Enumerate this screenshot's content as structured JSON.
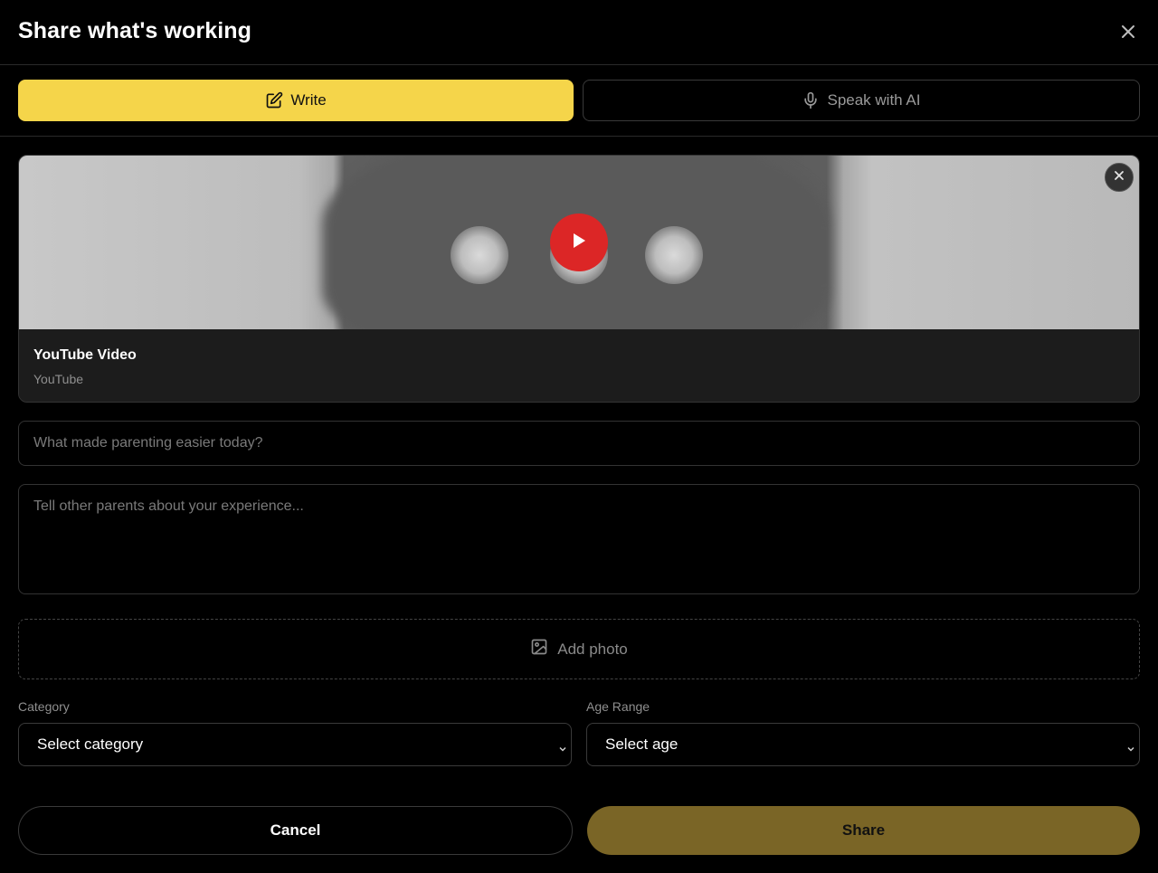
{
  "dialog": {
    "title": "Share what's working",
    "close_icon": "close-icon"
  },
  "modes": {
    "write": {
      "label": "Write",
      "icon": "edit-icon",
      "active": true,
      "color": "#f5d54a"
    },
    "speak": {
      "label": "Speak with AI",
      "icon": "microphone-icon",
      "active": false
    }
  },
  "video": {
    "title": "YouTube Video",
    "source": "YouTube",
    "play_icon": "play-icon",
    "remove_icon": "close-icon",
    "play_color": "#dc2626"
  },
  "form": {
    "title_placeholder": "What made parenting easier today?",
    "story_placeholder": "Tell other parents about your experience...",
    "add_photo_label": "Add photo",
    "add_photo_icon": "image-icon",
    "category": {
      "label": "Category",
      "selected": "Select category"
    },
    "age_range": {
      "label": "Age Range",
      "selected": "Select age"
    }
  },
  "actions": {
    "cancel_label": "Cancel",
    "share_label": "Share",
    "share_color": "#7a6526"
  }
}
